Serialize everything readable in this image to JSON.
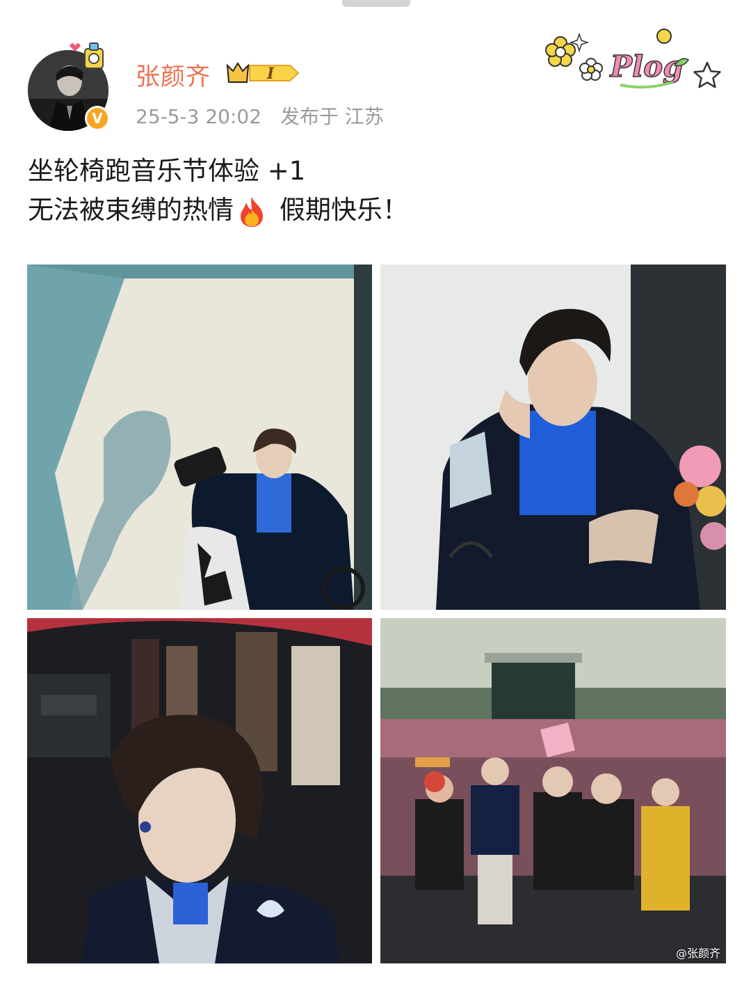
{
  "post": {
    "author": "张颜齐",
    "vip_level": "I",
    "verified_badge": "V",
    "date": "25-5-3 20:02",
    "location": "发布于 江苏",
    "content_line1": "坐轮椅跑音乐节体验 +1",
    "content_line2_a": "无法被束缚的热情",
    "content_line2_b": "假期快乐！",
    "emoji": "fire-icon",
    "plog_sticker": "Plog",
    "images": [
      {
        "name": "photo-wall-shadow"
      },
      {
        "name": "photo-flowers"
      },
      {
        "name": "photo-backstage"
      },
      {
        "name": "photo-crowd",
        "watermark": "@张颜齐"
      }
    ]
  },
  "colors": {
    "username": "#eb7350",
    "meta": "#9a9a9a",
    "verified": "#f6a623"
  }
}
